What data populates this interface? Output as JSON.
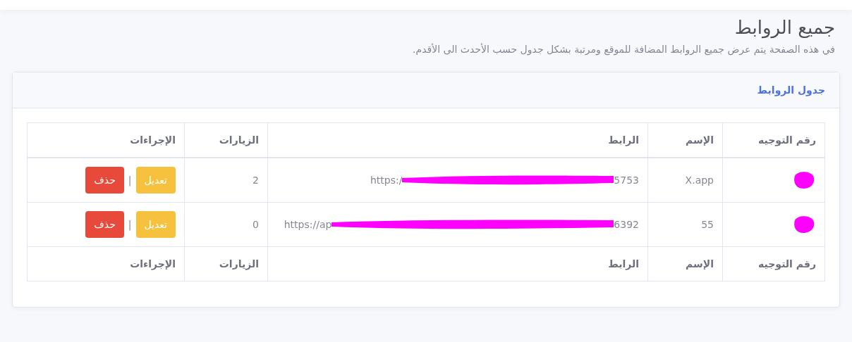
{
  "page": {
    "title": "جميع الروابط",
    "description": "في هذه الصفحة يتم عرض جميع الروابط المضافة للموقع ومرتبة بشكل جدول حسب الأحدث الى الأقدم."
  },
  "card": {
    "title": "جدول الروابط"
  },
  "table": {
    "columns": [
      "رقم التوجيه",
      "الإسم",
      "الرابط",
      "الزيارات",
      "الإجراءات"
    ],
    "rows": [
      {
        "id_redacted": true,
        "name": "X.app",
        "link_start": "https:/",
        "link_redacted": true,
        "link_end": "5753",
        "visits": "2",
        "actions": {
          "edit": "تعديل",
          "separator": "|",
          "delete": "حذف"
        }
      },
      {
        "id_redacted": true,
        "name": "55",
        "link_start": "https://ap",
        "link_redacted": true,
        "link_end": "6392",
        "visits": "0",
        "actions": {
          "edit": "تعديل",
          "separator": "|",
          "delete": "حذف"
        }
      }
    ],
    "footer": [
      "رقم التوجيه",
      "الإسم",
      "الرابط",
      "الزيارات",
      "الإجراءات"
    ]
  }
}
